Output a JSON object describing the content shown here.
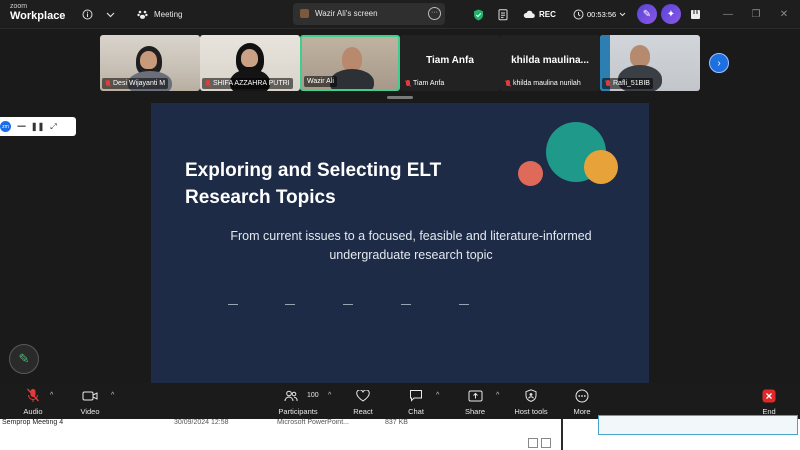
{
  "titlebar": {
    "brand_top": "zoom",
    "brand_bottom": "Workplace",
    "info_icon": "info-icon",
    "meeting_label": "Meeting",
    "share_label": "Wazir Ali's screen",
    "rec_label": "REC",
    "timer": "00:53:56"
  },
  "thumbnails": [
    {
      "name": "Desi Wijayanti M",
      "muted": true
    },
    {
      "name": "SHIFA AZZAHRA PUTRI",
      "muted": true
    },
    {
      "name": "Wazir Ali",
      "muted": false
    },
    {
      "name": "Tiam Anfa",
      "display_name": "Tiam Anfa",
      "muted": true
    },
    {
      "name": "khilda maulina nurilah",
      "display_name": "khilda maulina...",
      "muted": true
    },
    {
      "name": "Rafli_51BIB",
      "muted": true
    }
  ],
  "slide": {
    "title": "Exploring and Selecting ELT Research Topics",
    "subtitle": "From current issues to a focused, feasible and literature-informed undergraduate research topic",
    "accent_colors": {
      "teal": "#1f9a8a",
      "orange": "#e7a33a",
      "coral": "#e06a5a"
    }
  },
  "toolbar": {
    "audio": "Audio",
    "video": "Video",
    "participants": "Participants",
    "participants_count": "100",
    "react": "React",
    "chat": "Chat",
    "share": "Share",
    "host_tools": "Host tools",
    "more": "More",
    "end": "End"
  },
  "background_window": {
    "file_name": "Semprop Meeting 4",
    "date": "30/09/2024 12:58",
    "type": "Microsoft PowerPoint...",
    "size": "837 KB"
  }
}
